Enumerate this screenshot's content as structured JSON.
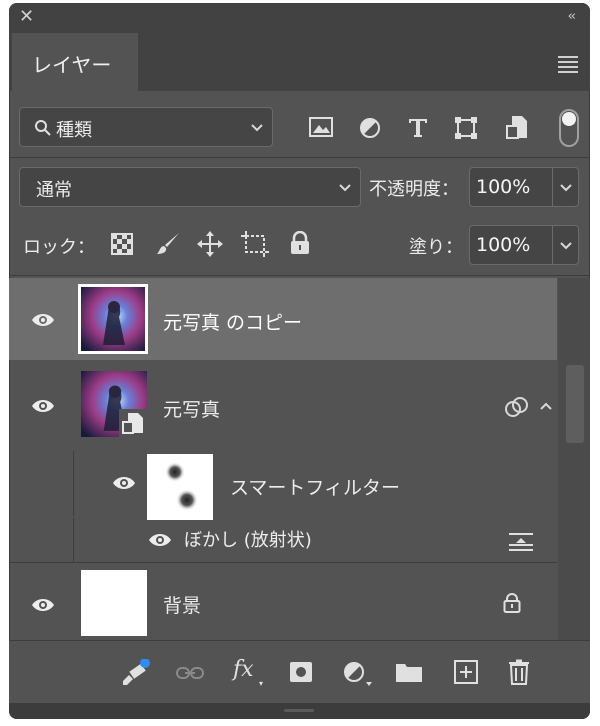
{
  "panel": {
    "close_glyph": "✕",
    "collapse_glyph": "‹‹",
    "tab_label": "レイヤー"
  },
  "filter": {
    "label": "種類",
    "icons": [
      "image-filter-icon",
      "adjustment-filter-icon",
      "type-filter-icon",
      "shape-filter-icon",
      "smart-object-filter-icon"
    ]
  },
  "blend": {
    "mode": "通常",
    "opacity_label": "不透明度：",
    "opacity_value": "100%"
  },
  "lock": {
    "label": "ロック：",
    "fill_label": "塗り：",
    "fill_value": "100%"
  },
  "layers": [
    {
      "name": "元写真 のコピー",
      "selected": true
    },
    {
      "name": "元写真"
    },
    {
      "name": "スマートフィルター"
    },
    {
      "name": "ぼかし (放射状)"
    },
    {
      "name": "背景"
    }
  ],
  "footer": {
    "fx_label": "fx"
  },
  "colors": {
    "panel": "#535353",
    "selected_row": "#6e6e6e",
    "badge": "#2f8cf0"
  }
}
